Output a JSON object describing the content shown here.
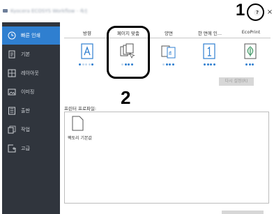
{
  "window": {
    "title": "Kyocera ECOSYS Workflow - 속성",
    "help_label": "?",
    "close_label": "×"
  },
  "callouts": {
    "help": "1",
    "page_fit": "2"
  },
  "sidebar": {
    "items": [
      {
        "label": "빠른 인쇄",
        "icon": "clock-icon",
        "active": true
      },
      {
        "label": "기본",
        "icon": "document-icon",
        "active": false
      },
      {
        "label": "레이아웃",
        "icon": "layout-grid-icon",
        "active": false
      },
      {
        "label": "이미징",
        "icon": "image-icon",
        "active": false
      },
      {
        "label": "출판",
        "icon": "publishing-icon",
        "active": false
      },
      {
        "label": "작업",
        "icon": "job-icon",
        "active": false
      },
      {
        "label": "고급",
        "icon": "advanced-icon",
        "active": false
      }
    ]
  },
  "tabs": [
    {
      "label": "방향",
      "icon": "orientation-icon"
    },
    {
      "label": "페이지 맞춤",
      "icon": "page-fit-icon"
    },
    {
      "label": "양면",
      "icon": "duplex-icon"
    },
    {
      "label": "한 면에 인...",
      "icon": "pages-per-sheet-icon"
    },
    {
      "label": "EcoPrint",
      "icon": "ecoprint-icon"
    }
  ],
  "reset_button": "다시 설정(R)",
  "profiles": {
    "label": "프린터 프로파일:",
    "items": [
      {
        "label": "팩토리 기본값",
        "icon": "blank-document-icon"
      }
    ]
  },
  "colors": {
    "accent": "#2f7fd0",
    "sidebar": "#30353d"
  }
}
